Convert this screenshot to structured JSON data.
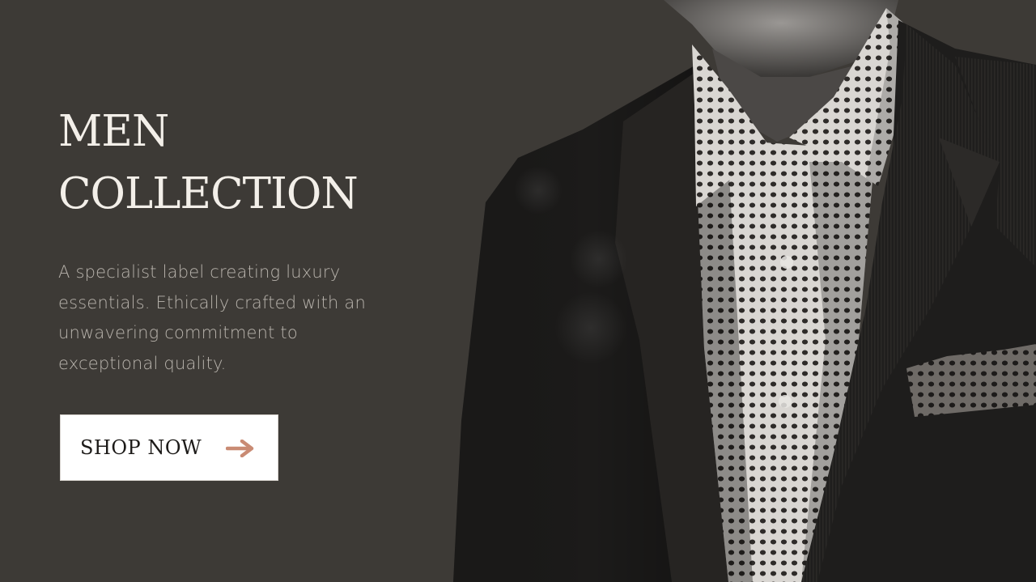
{
  "hero": {
    "title_line1": "MEN",
    "title_line2": "COLLECTION",
    "description_lines": [
      "A specialist label creating luxury",
      "essentials. Ethically crafted with an",
      "unwavering commitment to",
      "exceptional quality."
    ],
    "button_label": "SHOP NOW",
    "button_icon": "arrow-right-icon"
  },
  "colors": {
    "background": "#3d3a36",
    "heading": "#f3efe9",
    "body_text": "#b9b4ad",
    "button_bg": "#ffffff",
    "accent_arrow": "#c98b74"
  }
}
